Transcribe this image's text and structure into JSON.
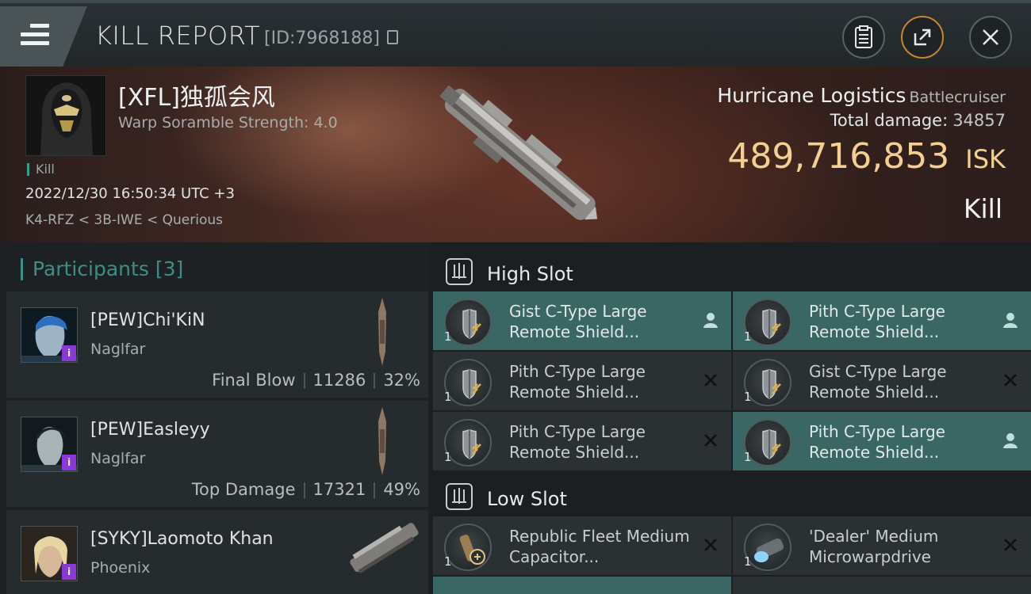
{
  "header": {
    "title": "KILL REPORT",
    "report_id": "[ID:7968188]"
  },
  "victim": {
    "name": "[XFL]独孤会风",
    "scramble": "Warp Soramble Strength: 4.0",
    "kill_tag": "Kill",
    "timestamp": "2022/12/30 16:50:34 UTC +3",
    "location": "K4-RFZ < 3B-IWE < Querious",
    "ship_name": "Hurricane Logistics",
    "ship_class": "Battlecruiser",
    "total_damage_label": "Total damage:",
    "total_damage": "34857",
    "isk_value": "489,716,853",
    "isk_unit": "ISK",
    "result": "Kill"
  },
  "participants": {
    "label": "Participants",
    "count": "[3]",
    "rows": [
      {
        "name": "[PEW]Chi'KiN",
        "ship": "Naglfar",
        "role": "Final Blow",
        "damage": "11286",
        "pct": "32%"
      },
      {
        "name": "[PEW]Easleyy",
        "ship": "Naglfar",
        "role": "Top Damage",
        "damage": "17321",
        "pct": "49%"
      },
      {
        "name": "[SYKY]Laomoto Khan",
        "ship": "Phoenix",
        "role": "",
        "damage": "",
        "pct": ""
      }
    ]
  },
  "fitting": {
    "high_slot_label": "High Slot",
    "low_slot_label": "Low Slot",
    "high": [
      {
        "name": "Gist C-Type Large Remote Shield...",
        "qty": "1",
        "status": "person-icon",
        "active": true
      },
      {
        "name": "Pith C-Type Large Remote Shield...",
        "qty": "1",
        "status": "person-icon",
        "active": true
      },
      {
        "name": "Pith C-Type Large Remote Shield...",
        "qty": "1",
        "status": "destroyed-x-icon",
        "active": false
      },
      {
        "name": "Gist C-Type Large Remote Shield...",
        "qty": "1",
        "status": "destroyed-x-icon",
        "active": false
      },
      {
        "name": "Pith C-Type Large Remote Shield...",
        "qty": "1",
        "status": "destroyed-x-icon",
        "active": false
      },
      {
        "name": "Pith C-Type Large Remote Shield...",
        "qty": "1",
        "status": "person-icon",
        "active": true
      }
    ],
    "low": [
      {
        "name": "Republic Fleet Medium Capacitor...",
        "qty": "1",
        "status": "destroyed-x-icon",
        "active": false
      },
      {
        "name": "'Dealer' Medium Microwarpdrive",
        "qty": "1",
        "status": "destroyed-x-icon",
        "active": false
      }
    ]
  },
  "colors": {
    "accent_teal": "#3f8d87",
    "isk_gold": "#f3cf92",
    "active_module": "#3a6764",
    "badge_purple": "#8a38d8"
  }
}
